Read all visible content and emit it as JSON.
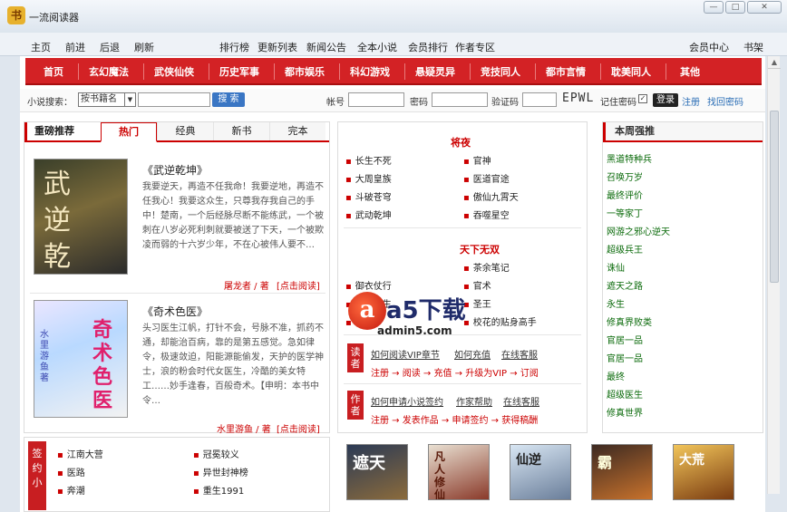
{
  "window": {
    "title": "一流阅读器",
    "buttons": [
      "—",
      "□",
      "✕"
    ]
  },
  "toolbar": {
    "left": [
      "主页",
      "前进",
      "后退",
      "刷新"
    ],
    "center": [
      "排行榜",
      "更新列表",
      "新闻公告",
      "全本小说",
      "会员排行",
      "作者专区"
    ],
    "right": [
      "会员中心",
      "书架"
    ]
  },
  "nav": [
    "首页",
    "玄幻魔法",
    "武侠仙侠",
    "历史军事",
    "都市娱乐",
    "科幻游戏",
    "悬疑灵异",
    "竞技同人",
    "都市言情",
    "耽美同人",
    "其他"
  ],
  "search": {
    "label": "小说搜索：",
    "select_value": "按书籍名",
    "button": "搜 索",
    "account_label": "帐号",
    "password_label": "密码",
    "captcha_label": "验证码",
    "captcha_text": "EPWL",
    "remember_label": "记住密码",
    "login": "登录",
    "register": "注册",
    "forgot": "找回密码"
  },
  "featured": {
    "title": "重磅推荐",
    "tabs": [
      "热门",
      "经典",
      "新书",
      "完本"
    ],
    "books": [
      {
        "title": "《武逆乾坤》",
        "cover_text": "武逆乾坤",
        "desc": "我要逆天，再造不任我命！我要逆地，再造不任我心！我要这众生，只尊我存我自己的手中！楚南，一个后经脉尽断不能练武，一个被刺在八岁必死利刺就要被送了下天，一个被欺凌而弱的十六岁少年，不在心被伟人要不…",
        "author": "屠龙者 / 著",
        "read": "[点击阅读]"
      },
      {
        "title": "《奇术色医》",
        "cover_text": "奇术色医",
        "cover_side": "水里游鱼著",
        "desc": "头习医生江帆，打针不会，号脉不准，抓药不通，却能治百病，靠的是第五感觉。急如律令，极速敛迫，阳能源能偷发，天护的医学神士，浪的粉会时代女医生，冷酷的美女特工……妙手逢春，百般奇术。【申明：本书中令…",
        "author": "水里游鱼 / 著",
        "read": "[点击阅读]"
      }
    ]
  },
  "middle": {
    "section1": "将夜",
    "list1": [
      [
        "长生不死",
        "官神"
      ],
      [
        "大周皇族",
        "医道官途"
      ],
      [
        "斗破苍穹",
        "傲仙九霄天"
      ],
      [
        "武动乾坤",
        "吞噬星空"
      ]
    ],
    "section2": "天下无双",
    "list2": [
      [
        "",
        "茶余笔记"
      ],
      [
        "御衣仗行",
        "官术"
      ],
      [
        "天才医生",
        "圣王"
      ],
      [
        "官家",
        "校花的贴身高手"
      ]
    ],
    "reader": {
      "badge": "读者",
      "links": [
        "如何阅读VIP章节",
        "如何充值",
        "在线客服"
      ],
      "flow": [
        "注册",
        "阅读",
        "充值",
        "升级为VIP",
        "订阅"
      ]
    },
    "author": {
      "badge": "作者",
      "links": [
        "如何申请小说签约",
        "作家帮助",
        "在线客服"
      ],
      "flow": [
        "注册",
        "发表作品",
        "申请签约",
        "获得稿酬"
      ]
    }
  },
  "right": {
    "title": "本周强推",
    "items": [
      "黑道特种兵",
      "召唤万岁",
      "最终评价",
      "一等家丁",
      "网游之邪心逆天",
      "超级兵王",
      "诛仙",
      "遮天之路",
      "永生",
      "修真界败类",
      "官居一品",
      "官居一品",
      "最终",
      "超级医生",
      "修真世界"
    ]
  },
  "bottom": {
    "badge": "签约小",
    "col1": [
      "江南大营",
      "医路",
      "奔潮"
    ],
    "col2": [
      "冠冕较义",
      "异世封神榜",
      "重生1991"
    ],
    "covers": [
      "遮天",
      "凡人修仙",
      "仙逆",
      "霸",
      "大荒"
    ]
  },
  "watermark": {
    "brand": "a5下载",
    "url": "admin5.com"
  },
  "colors": {
    "accent": "#d32225",
    "link": "#2a6db5",
    "rank": "#0a6a0a"
  }
}
